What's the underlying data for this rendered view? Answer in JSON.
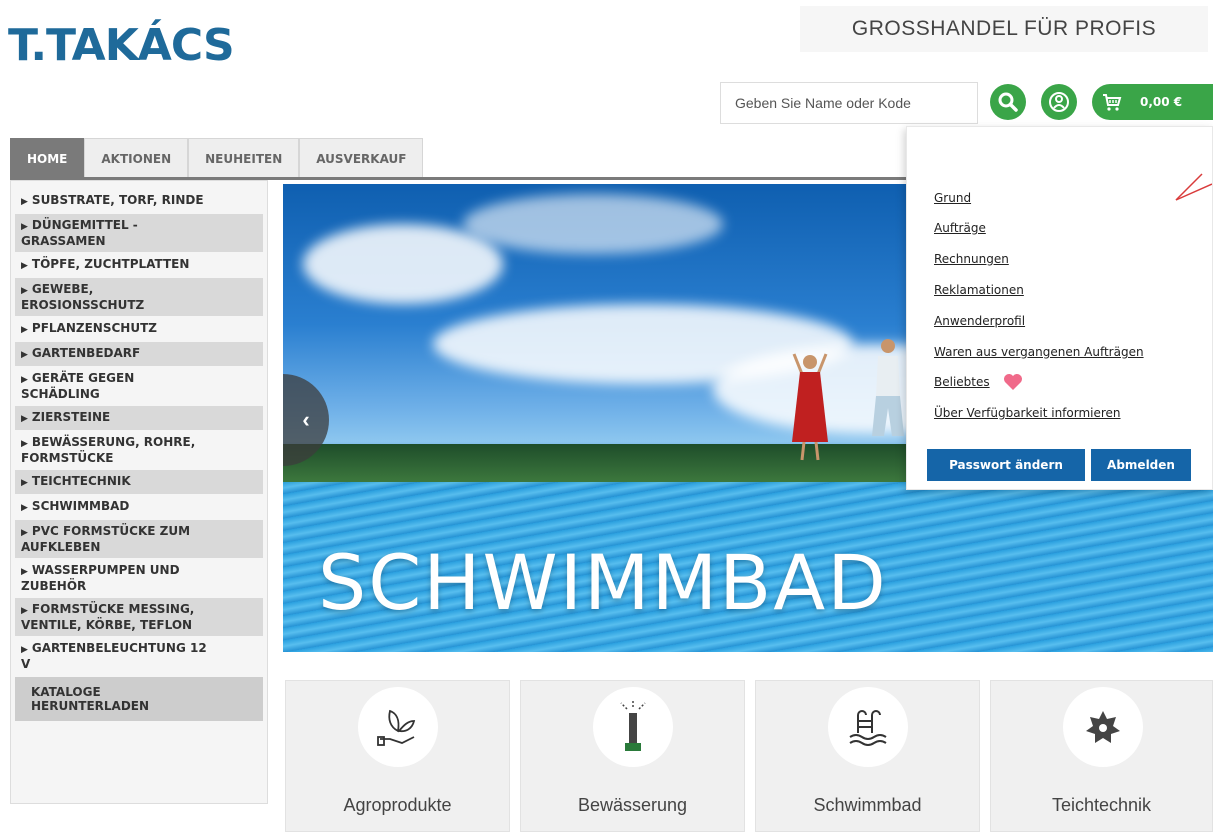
{
  "header": {
    "logo_text": "T.TAKÁCS",
    "tagline": "GROSSHANDEL FÜR PROFIS",
    "search_placeholder": "Geben Sie Name oder Kode",
    "cart_amount": "0,00 €",
    "accent_color": "#3aa548",
    "brand_color": "#1f6a9a"
  },
  "tabs": [
    {
      "label": "HOME",
      "active": true
    },
    {
      "label": "AKTIONEN",
      "active": false
    },
    {
      "label": "NEUHEITEN",
      "active": false
    },
    {
      "label": "AUSVERKAUF",
      "active": false
    }
  ],
  "sidebar": {
    "items": [
      {
        "label": "SUBSTRATE, TORF, RINDE"
      },
      {
        "label": "DÜNGEMITTEL -\nGRASSAMEN"
      },
      {
        "label": "TÖPFE, ZUCHTPLATTEN"
      },
      {
        "label": "GEWEBE,\nEROSIONSSCHUTZ"
      },
      {
        "label": "PFLANZENSCHUTZ"
      },
      {
        "label": "GARTENBEDARF"
      },
      {
        "label": "GERÄTE GEGEN\nSCHÄDLING"
      },
      {
        "label": "ZIERSTEINE"
      },
      {
        "label": "BEWÄSSERUNG, ROHRE,\nFORMSTÜCKE"
      },
      {
        "label": "TEICHTECHNIK"
      },
      {
        "label": "SCHWIMMBAD"
      },
      {
        "label": "PVC FORMSTÜCKE ZUM\nAUFKLEBEN"
      },
      {
        "label": "WASSERPUMPEN UND\nZUBEHÖR"
      },
      {
        "label": "FORMSTÜCKE MESSING,\nVENTILE, KÖRBE, TEFLON"
      },
      {
        "label": "GARTENBELEUCHTUNG 12\nV"
      }
    ],
    "catalog_label": "KATALOGE\nHERUNTERLADEN"
  },
  "hero": {
    "title": "SCHWIMMBAD"
  },
  "account_menu": {
    "links": [
      "Grund",
      "Aufträge",
      "Rechnungen",
      "Reklamationen",
      "Anwenderprofil",
      "Waren aus vergangenen Aufträgen",
      "Beliebtes",
      "Über Verfügbarkeit informieren"
    ],
    "change_password_label": "Passwort ändern",
    "logout_label": "Abmelden"
  },
  "categories": [
    {
      "label": "Agroprodukte",
      "icon": "plant-hand-icon"
    },
    {
      "label": "Bewässerung",
      "icon": "sprinkler-icon"
    },
    {
      "label": "Schwimmbad",
      "icon": "pool-ladder-icon"
    },
    {
      "label": "Teichtechnik",
      "icon": "gear-leaf-icon"
    }
  ]
}
